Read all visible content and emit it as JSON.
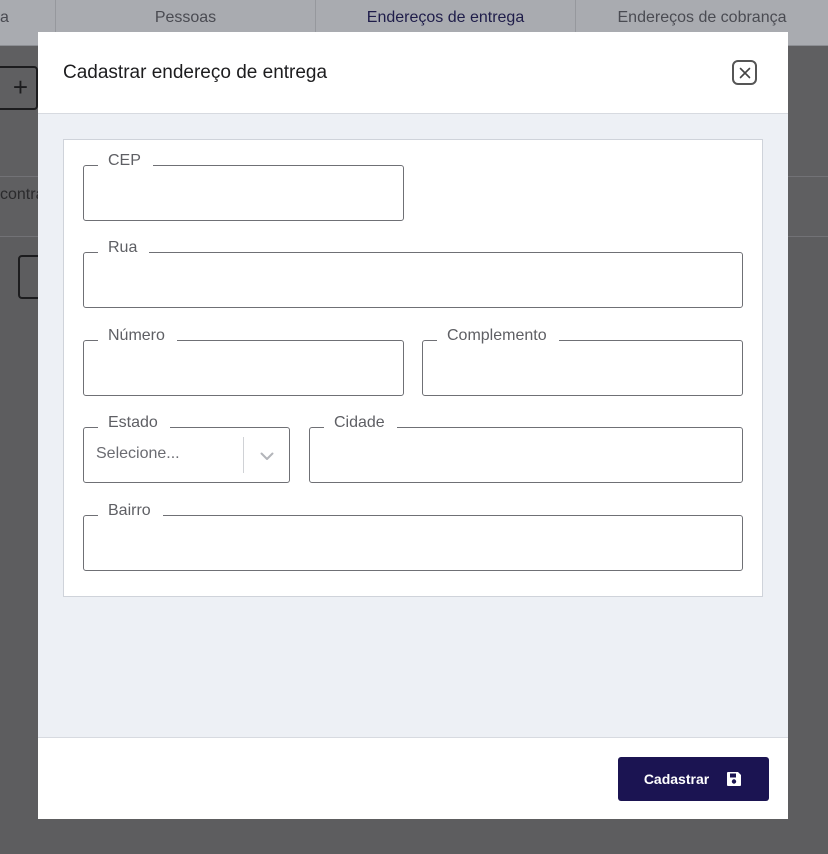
{
  "background": {
    "tabs": [
      {
        "label": "a"
      },
      {
        "label": "Pessoas"
      },
      {
        "label": "Endereços de entrega"
      },
      {
        "label": "Endereços de cobrança"
      }
    ],
    "add_button_icon": "plus-icon",
    "partial_text": "contra"
  },
  "modal": {
    "title": "Cadastrar endereço de entrega",
    "close_icon": "close-icon",
    "fields": {
      "cep": {
        "label": "CEP",
        "value": ""
      },
      "rua": {
        "label": "Rua",
        "value": ""
      },
      "numero": {
        "label": "Número",
        "value": ""
      },
      "complemento": {
        "label": "Complemento",
        "value": ""
      },
      "estado": {
        "label": "Estado",
        "placeholder": "Selecione...",
        "icon": "chevron-down-icon"
      },
      "cidade": {
        "label": "Cidade",
        "value": ""
      },
      "bairro": {
        "label": "Bairro",
        "value": ""
      }
    },
    "submit": {
      "label": "Cadastrar",
      "icon": "save-icon"
    }
  },
  "colors": {
    "primary": "#1b1452",
    "overlay": "#5d5d5f",
    "body_bg": "#edf0f5"
  }
}
